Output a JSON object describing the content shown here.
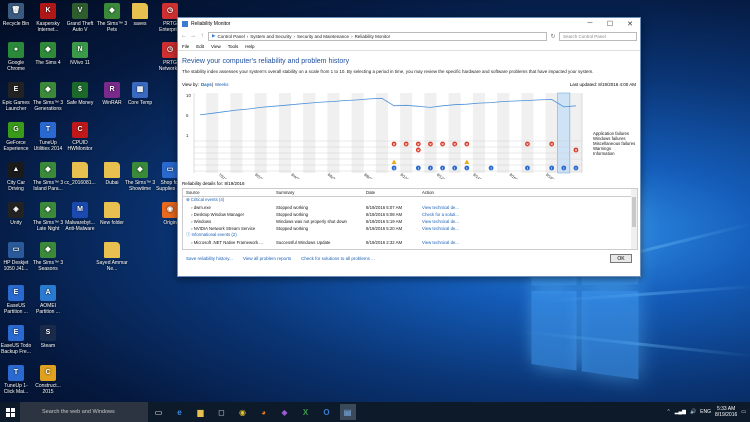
{
  "desktop": {
    "icons": [
      {
        "label": "Recycle Bin",
        "glyph": "🗑",
        "color": "#3a5a80"
      },
      {
        "label": "Kaspersky Internet...",
        "glyph": "K",
        "color": "#b01818"
      },
      {
        "label": "Grand Theft Auto V",
        "glyph": "V",
        "color": "#2e5e2e"
      },
      {
        "label": "The Sims™ 3 Pets",
        "glyph": "◆",
        "color": "#3a8a3a"
      },
      {
        "label": "saves",
        "glyph": "",
        "color": "#e8c050"
      },
      {
        "label": "PRTG Enterpri...",
        "glyph": "◷",
        "color": "#d03030"
      },
      {
        "label": "Google Chrome",
        "glyph": "●",
        "color": "#2a8a3a"
      },
      {
        "label": "The Sims 4",
        "glyph": "◆",
        "color": "#2f8a3a"
      },
      {
        "label": "NVivo 11",
        "glyph": "N",
        "color": "#3a9a4a"
      },
      {
        "label": "PRTG Network...",
        "glyph": "◷",
        "color": "#d03030"
      },
      {
        "label": "Epic Games Launcher",
        "glyph": "E",
        "color": "#222"
      },
      {
        "label": "The Sims™ 3 Generations",
        "glyph": "◆",
        "color": "#3a8a3a"
      },
      {
        "label": "Safe Money",
        "glyph": "$",
        "color": "#1c6a2a"
      },
      {
        "label": "WinRAR",
        "glyph": "R",
        "color": "#7a2a8a"
      },
      {
        "label": "Core Temp",
        "glyph": "▦",
        "color": "#3a6ac0"
      },
      {
        "label": "GeForce Experience",
        "glyph": "G",
        "color": "#3a9a1a"
      },
      {
        "label": "TuneUp Utilities 2014",
        "glyph": "T",
        "color": "#2a6ad0"
      },
      {
        "label": "CPUID HWMonitor",
        "glyph": "C",
        "color": "#c01818"
      },
      {
        "label": "City Car Driving",
        "glyph": "▲",
        "color": "#1a1a1a"
      },
      {
        "label": "The Sims™ 3 Island Para...",
        "glyph": "◆",
        "color": "#3a8a3a"
      },
      {
        "label": "cc_2016081...",
        "glyph": "",
        "color": "#e8c050"
      },
      {
        "label": "Dubai",
        "glyph": "",
        "color": "#e8c050"
      },
      {
        "label": "The Sims™ 3 Showtime",
        "glyph": "◆",
        "color": "#3a8a3a"
      },
      {
        "label": "Shop for Supplies - ...",
        "glyph": "▭",
        "color": "#2a6ad0"
      },
      {
        "label": "Unity",
        "glyph": "◈",
        "color": "#222"
      },
      {
        "label": "The Sims™ 3 Late Night",
        "glyph": "◆",
        "color": "#3a8a3a"
      },
      {
        "label": "Malwarebyt... Anti-Malware",
        "glyph": "M",
        "color": "#1a4ab0"
      },
      {
        "label": "New folder",
        "glyph": "",
        "color": "#e8c050"
      },
      {
        "label": "Origin",
        "glyph": "◉",
        "color": "#e86a20"
      },
      {
        "label": "HP Deskjet 1050 J41...",
        "glyph": "▭",
        "color": "#2a5a9a"
      },
      {
        "label": "The Sims™ 3 Seasons",
        "glyph": "◆",
        "color": "#3a8a3a"
      },
      {
        "label": "Sayed Ammar Ne...",
        "glyph": "",
        "color": "#e8c050"
      },
      {
        "label": "EaseUS Partition ...",
        "glyph": "E",
        "color": "#2a6ad0"
      },
      {
        "label": "AOMEI Partition ...",
        "glyph": "A",
        "color": "#2a7ad0"
      },
      {
        "label": "EaseUS Todo Backup Fre...",
        "glyph": "E",
        "color": "#2a6ad0"
      },
      {
        "label": "Steam",
        "glyph": "S",
        "color": "#1a2a4a"
      },
      {
        "label": "TuneUp 1-Click Mai...",
        "glyph": "T",
        "color": "#2a6ad0"
      },
      {
        "label": "Construct... 2015",
        "glyph": "C",
        "color": "#e0a020"
      }
    ]
  },
  "window": {
    "title": "Reliability Monitor",
    "controls": {
      "minimize": "─",
      "maximize": "☐",
      "close": "✕"
    },
    "address": {
      "crumbs": [
        "Control Panel",
        "System and Security",
        "Security and Maintenance",
        "Reliability Monitor"
      ],
      "search_placeholder": "Search Control Panel"
    },
    "menu": [
      "File",
      "Edit",
      "View",
      "Tools",
      "Help"
    ],
    "heading": "Review your computer's reliability and problem history",
    "description": "The stability index assesses your system's overall stability on a scale from 1 to 10. By selecting a period in time, you may review the specific hardware and software problems that have impacted your system.",
    "view_by": {
      "label": "View by:",
      "days": "Days",
      "weeks": "Weeks"
    },
    "last_updated": "Last updated: 8/19/2016 4:00 AM",
    "legend": [
      "Application failures",
      "Windows failures",
      "Miscellaneous failures",
      "Warnings",
      "Information"
    ],
    "details_title": "Reliability details for: 8/19/2016",
    "columns": [
      "Source",
      "Summary",
      "Date",
      "Action"
    ],
    "critical_group": "Critical events (4)",
    "rows": [
      {
        "source": "dwm.exe",
        "summary": "Stopped working",
        "date": "8/19/2016 5:07 AM",
        "action": "View technical de..."
      },
      {
        "source": "Desktop Window Manager",
        "summary": "Stopped working",
        "date": "8/19/2016 5:08 AM",
        "action": "Check for a soluti..."
      },
      {
        "source": "Windows",
        "summary": "Windows was not properly shut down",
        "date": "8/19/2016 5:19 AM",
        "action": "View technical de..."
      },
      {
        "source": "NVIDIA Network Stream Service",
        "summary": "Stopped working",
        "date": "8/19/2016 5:20 AM",
        "action": "View technical de..."
      }
    ],
    "info_group": "Informational events (2)",
    "info_rows": [
      {
        "source": "Microsoft .NET Native Framework ...",
        "summary": "Successful Windows Update",
        "date": "8/19/2016 2:32 AM",
        "action": "View technical de..."
      }
    ],
    "footer": {
      "save_link": "Save reliability history...",
      "all_reports": "View all problem reports",
      "check_solutions": "Check for solutions to all problems ...",
      "ok": "OK"
    }
  },
  "chart_data": {
    "type": "line",
    "y_scale": [
      10,
      5,
      1
    ],
    "x_labels": [
      "7/31/2016",
      "8/2/2016",
      "8/4/2016",
      "8/6/2016",
      "8/8/2016",
      "8/10/2016",
      "8/12/2016",
      "8/14/2016",
      "8/16/2016",
      "8/18/2016"
    ],
    "stability_index": [
      5.9,
      6.2,
      6.5,
      6.8,
      7.0,
      7.3,
      7.5,
      7.7,
      7.9,
      8.1,
      8.3,
      8.4,
      8.6,
      8.7,
      8.9,
      9.0,
      7.6,
      7.7,
      7.5,
      7.3,
      7.6,
      7.8,
      7.9,
      8.1,
      8.2,
      8.4,
      8.5,
      8.6,
      8.7,
      8.8,
      7.4,
      7.6
    ],
    "app_failures": [
      16,
      17,
      18,
      19,
      20,
      21,
      22,
      27,
      29
    ],
    "windows_failures": [
      18,
      31
    ],
    "warnings": [
      16,
      22
    ],
    "information": [
      16,
      18,
      19,
      20,
      21,
      22,
      24,
      27,
      29,
      30,
      31
    ]
  },
  "taskbar": {
    "search_placeholder": "Search the web and Windows",
    "tray_lang": "ENG",
    "time": "5:33 AM",
    "date": "8/19/2016"
  }
}
